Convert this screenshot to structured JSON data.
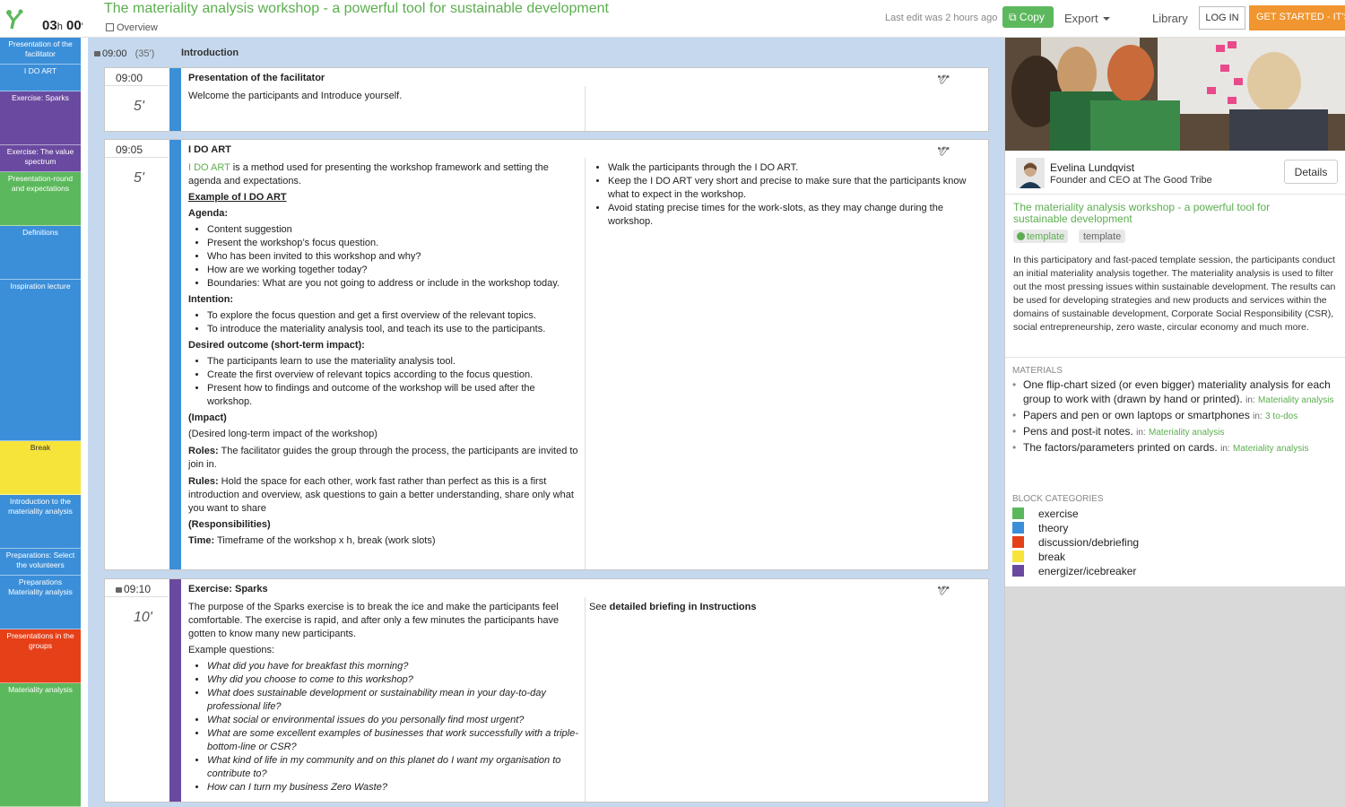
{
  "header": {
    "duration_hours": "03",
    "duration_h_unit": "h",
    "duration_minutes": "00",
    "duration_min_unit": "'",
    "title": "The materiality analysis workshop - a powerful tool for sustainable development",
    "overview_label": "Overview",
    "last_edit": "Last edit was 2 hours ago",
    "copy_label": "Copy",
    "export_label": "Export",
    "library_label": "Library",
    "login_label": "LOG IN",
    "get_started_label": "GET STARTED - IT'S FREE"
  },
  "sidebar": {
    "items": [
      {
        "label": "Presentation of the facilitator",
        "category": "theory"
      },
      {
        "label": "I DO ART",
        "category": "theory"
      },
      {
        "label": "Exercise: Sparks",
        "category": "energizer"
      },
      {
        "label": "Exercise: The value spectrum",
        "category": "energizer"
      },
      {
        "label": "Presentation-round and expectations",
        "category": "exercise"
      },
      {
        "label": "Definitions",
        "category": "theory"
      },
      {
        "label": "Inspiration lecture",
        "category": "theory"
      },
      {
        "label": "Break",
        "category": "break"
      },
      {
        "label": "Introduction to the materiality analysis",
        "category": "theory"
      },
      {
        "label": "Preparations: Select the volunteers",
        "category": "theory"
      },
      {
        "label": "Preparations Materiality analysis",
        "category": "theory"
      },
      {
        "label": "Presentations in the groups",
        "category": "discussion"
      },
      {
        "label": "Materiality analysis",
        "category": "exercise"
      }
    ]
  },
  "session": {
    "time": "09:00",
    "duration": "(35')",
    "title": "Introduction"
  },
  "blocks": [
    {
      "time": "09:00",
      "duration": "5'",
      "title": "Presentation of the facilitator",
      "tools": "•••",
      "body": "Welcome the participants and Introduce yourself."
    },
    {
      "time": "09:05",
      "duration": "5'",
      "title": "I DO ART",
      "tools": "•••",
      "intro_link": "I DO ART",
      "intro_text": " is a method used for presenting the workshop framework and setting the agenda and expectations.",
      "example_link": "Example of I DO ART",
      "agenda_heading": "Agenda:",
      "agenda": [
        "Content suggestion",
        "Present the workshop’s focus question.",
        "Who has been invited to this workshop and why?",
        "How are we working together today?",
        "Boundaries: What are you not going to address or include in the workshop today."
      ],
      "intention_heading": "Intention:",
      "intention": [
        "To explore the focus question and get a first overview of the relevant topics.",
        "To introduce the materiality analysis tool, and teach its use to the participants."
      ],
      "outcome_heading": "Desired outcome (short-term impact):",
      "outcome": [
        "The participants learn to use the materiality analysis tool.",
        "Create the first overview of relevant topics according to the focus question.",
        "Present how to findings and outcome of the workshop will be used after the workshop."
      ],
      "impact_heading": "(Impact)",
      "impact_text": "(Desired long-term impact of the workshop)",
      "roles_label": "Roles:",
      "roles_text": " The facilitator guides the group through the process, the participants are invited to join in.",
      "rules_label": "Rules:",
      "rules_text": " Hold the space for each other, work fast rather than perfect as this is a first introduction and overview, ask questions to gain a better understanding, share only what you want to share",
      "responsibilities_heading": "(Responsibilities)",
      "time_label": "Time:",
      "time_text": " Timeframe of the workshop x h, break (work slots)",
      "instructions": [
        "Walk the participants through the I DO ART.",
        "Keep the I DO ART very short and precise to make sure that the participants know what to expect in the workshop.",
        "Avoid stating precise times for the work-slots, as they may change during the workshop."
      ]
    },
    {
      "time": "09:10",
      "duration": "10'",
      "title": "Exercise: Sparks",
      "tools": "•••",
      "intro_text": "The purpose of the Sparks exercise is to break the ice and make the participants feel comfortable. The exercise is rapid, and after only a few minutes the participants have gotten to know many new participants.",
      "questions_heading": "Example questions:",
      "questions": [
        "What did you have for breakfast this morning?",
        "Why did you choose to come to this workshop?",
        "What does sustainable development or sustainability mean in your day-to-day professional life?",
        "What social or environmental issues do you personally find most urgent?",
        "What are some excellent examples of businesses that work successfully with a triple-bottom-line or CSR?",
        "What kind of life in my community and on this planet do I want my organisation to contribute to?",
        "How can I turn my business Zero Waste?"
      ],
      "see_text": "See ",
      "see_bold": "detailed briefing in Instructions"
    }
  ],
  "author": {
    "name": "Evelina Lundqvist",
    "role": "Founder and CEO at The Good Tribe",
    "details_label": "Details"
  },
  "summary": {
    "title": "The materiality analysis workshop - a powerful tool for sustainable development",
    "tag_public": "template",
    "tag_plain": "template",
    "description": "In this participatory and fast-paced template session, the participants conduct an initial materiality analysis together. The materiality analysis is used to filter out the most pressing issues within sustainable development. The results can be used for developing strategies and new products and services within the domains of sustainable development, Corporate Social Responsibility (CSR), social entrepreneurship, zero waste, circular economy and much more."
  },
  "materials": {
    "heading": "MATERIALS",
    "in_label": "in:",
    "items": [
      {
        "text": "One flip-chart sized (or even bigger) materiality analysis for each group to work with (drawn by hand or printed).",
        "ref": "Materiality analysis"
      },
      {
        "text": "Papers and pen or own laptops or smartphones",
        "ref": "3 to-dos"
      },
      {
        "text": "Pens and post-it notes.",
        "ref": "Materiality analysis"
      },
      {
        "text": "The factors/parameters printed on cards.",
        "ref": "Materiality analysis"
      }
    ]
  },
  "categories": {
    "heading": "BLOCK CATEGORIES",
    "items": [
      {
        "label": "exercise",
        "color": "#5cb85c"
      },
      {
        "label": "theory",
        "color": "#3b8fd9"
      },
      {
        "label": "discussion/debriefing",
        "color": "#e64019"
      },
      {
        "label": "break",
        "color": "#f7e43b"
      },
      {
        "label": "energizer/icebreaker",
        "color": "#6a4aa0"
      }
    ]
  },
  "colors": {
    "brand_green": "#5cae4f",
    "theory": "#3b8fd9",
    "exercise": "#5cb85c",
    "energizer": "#6a4aa0",
    "break": "#f7e43b",
    "discussion": "#e64019",
    "get_started": "#f0952f"
  },
  "icons": {
    "logo": "sessionlab-logo-icon",
    "overview": "panel-icon",
    "lock": "lock-icon",
    "tools": "ellipsis-icon",
    "attachment": "paperclip-icon",
    "globe": "globe-icon",
    "caret": "caret-down-icon"
  }
}
